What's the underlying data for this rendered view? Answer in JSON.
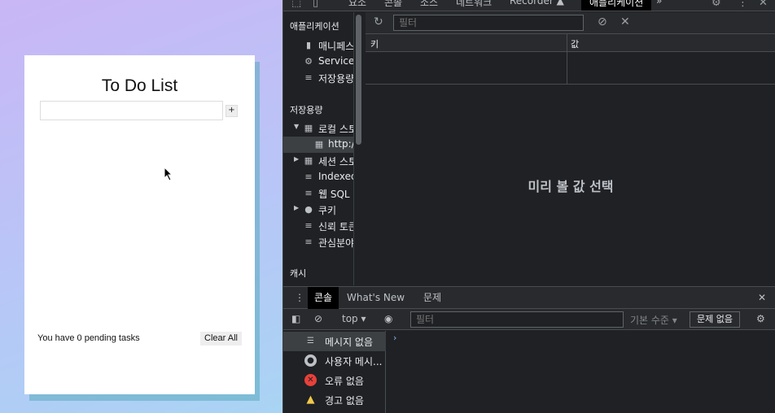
{
  "todo": {
    "title": "To Do List",
    "input_placeholder": "",
    "add_label": "+",
    "pending_text": "You have 0 pending tasks",
    "clear_label": "Clear All"
  },
  "devtools": {
    "tabs": [
      "요소",
      "콘솔",
      "소스",
      "네트워크",
      "Recorder ▲",
      "애플리케이션",
      "»"
    ],
    "active_tab": "애플리케이션",
    "sidebar": {
      "app_heading": "애플리케이션",
      "app_items": [
        "매니페스",
        "Service",
        "저장용량"
      ],
      "storage_heading": "저장용량",
      "storage_items": [
        "로컬 스토",
        "http:/",
        "세션 스토",
        "Indexed",
        "웹 SQL",
        "쿠키",
        "신뢰 토큰",
        "관심분야"
      ],
      "cache_heading": "캐시"
    },
    "storage_filter_placeholder": "필터",
    "table_headers": [
      "키",
      "값"
    ],
    "preview_text": "미리 볼 값 선택",
    "drawer_tabs": [
      "콘솔",
      "What's New",
      "문제"
    ],
    "console": {
      "context": "top",
      "filter_placeholder": "필터",
      "level": "기본 수준",
      "issues": "문제 없음"
    },
    "messages": [
      "메시지 없음",
      "사용자 메시...",
      "오류 없음",
      "경고 없음"
    ]
  },
  "colors": {
    "devtools_bg": "#202124",
    "error": "#e8413b",
    "warning": "#f2c94c",
    "link": "#8ab4f8"
  }
}
